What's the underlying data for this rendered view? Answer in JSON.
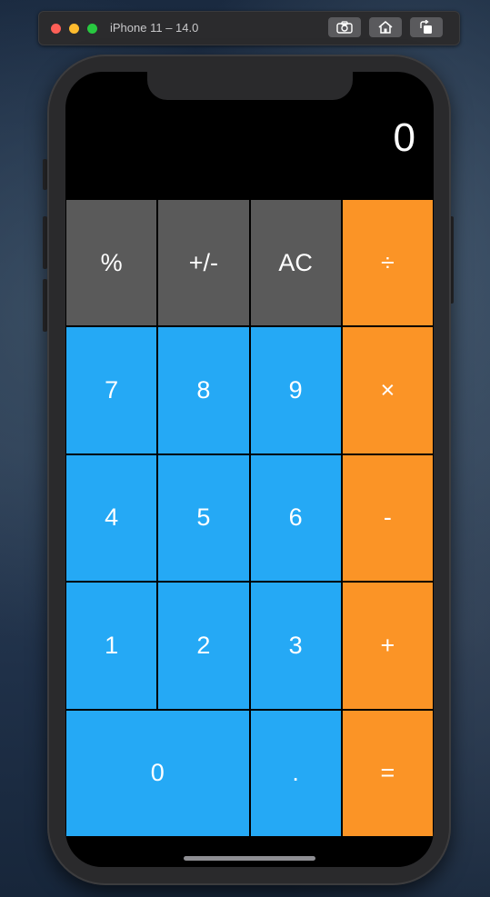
{
  "simulator": {
    "title": "iPhone 11 – 14.0",
    "buttons": [
      {
        "name": "screenshot",
        "icon": "camera-icon"
      },
      {
        "name": "home",
        "icon": "home-icon"
      },
      {
        "name": "rotate",
        "icon": "rotate-icon"
      }
    ]
  },
  "calculator": {
    "display_value": "0",
    "colors": {
      "function_key": "#5a5a5a",
      "digit_key": "#25a9f5",
      "operator_key": "#fb9426",
      "background": "#000000"
    },
    "rows": [
      [
        {
          "label": "%",
          "type": "function"
        },
        {
          "label": "+/-",
          "type": "function"
        },
        {
          "label": "AC",
          "type": "function"
        },
        {
          "label": "÷",
          "type": "operator"
        }
      ],
      [
        {
          "label": "7",
          "type": "digit"
        },
        {
          "label": "8",
          "type": "digit"
        },
        {
          "label": "9",
          "type": "digit"
        },
        {
          "label": "×",
          "type": "operator"
        }
      ],
      [
        {
          "label": "4",
          "type": "digit"
        },
        {
          "label": "5",
          "type": "digit"
        },
        {
          "label": "6",
          "type": "digit"
        },
        {
          "label": "-",
          "type": "operator"
        }
      ],
      [
        {
          "label": "1",
          "type": "digit"
        },
        {
          "label": "2",
          "type": "digit"
        },
        {
          "label": "3",
          "type": "digit"
        },
        {
          "label": "+",
          "type": "operator"
        }
      ],
      [
        {
          "label": "0",
          "type": "digit"
        },
        {
          "label": ".",
          "type": "digit"
        },
        {
          "label": "=",
          "type": "operator"
        }
      ]
    ]
  }
}
